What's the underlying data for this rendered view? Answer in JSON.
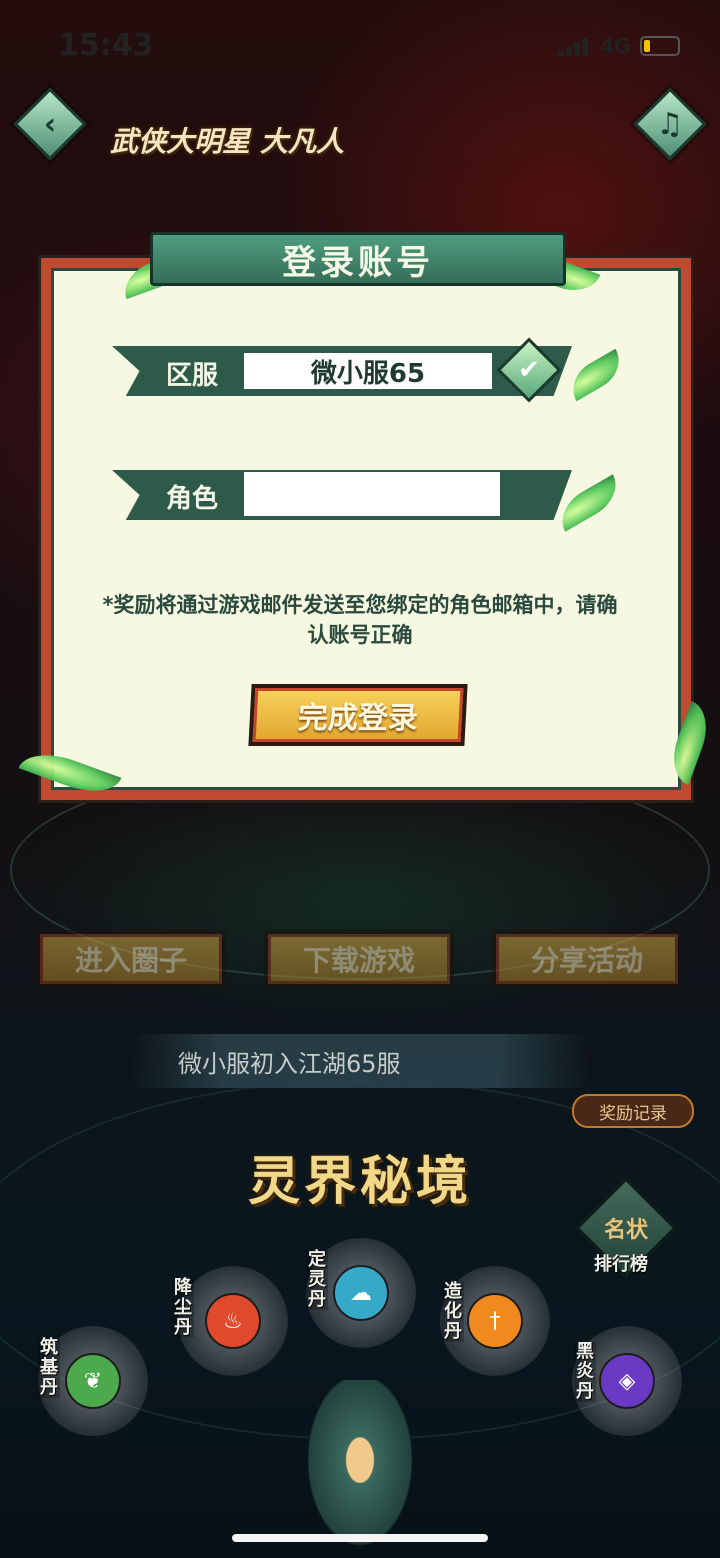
{
  "status_bar": {
    "time": "15:43",
    "network": "4G",
    "colors": {
      "battery_level": "#f2c200"
    }
  },
  "header": {
    "back_icon": "chevron-left-icon",
    "music_icon": "music-note-icon",
    "logo_text": "武侠大明星",
    "logo_text_2": "大凡人"
  },
  "modal": {
    "title": "登录账号",
    "server_label": "区服",
    "server_value": "微小服65",
    "dropdown_icon": "chevron-down-icon",
    "role_label": "角色",
    "role_value": "",
    "notice": "*奖励将通过游戏邮件发送至您绑定的角色邮箱中，请确认账号正确",
    "confirm_button": "完成登录"
  },
  "actions": {
    "join_circle": "进入圈子",
    "download_game": "下载游戏",
    "share_activity": "分享活动"
  },
  "ticker": {
    "text": "微小服初入江湖65服"
  },
  "reward_record": "奖励记录",
  "realm": {
    "title": "灵界秘境",
    "rank_icon_text": "名状",
    "rank_label": "排行榜",
    "orbs": [
      {
        "label": "筑基丹",
        "color": "#4caa4c",
        "icon": "leaf-icon"
      },
      {
        "label": "降尘丹",
        "color": "#e04a2c",
        "icon": "flame-icon"
      },
      {
        "label": "定灵丹",
        "color": "#36a9c9",
        "icon": "cloud-icon"
      },
      {
        "label": "造化丹",
        "color": "#f08a1e",
        "icon": "sword-icon"
      },
      {
        "label": "黑炎丹",
        "color": "#6a3ac4",
        "icon": "shield-icon"
      }
    ]
  }
}
